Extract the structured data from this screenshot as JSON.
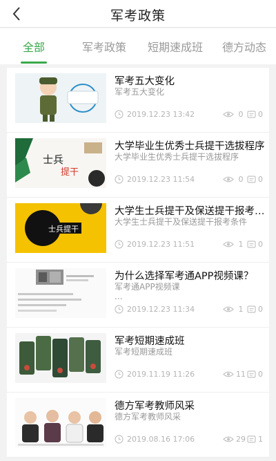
{
  "header": {
    "title": "军考政策",
    "back_icon": "chevron-left-icon"
  },
  "tabs": [
    {
      "label": "全部",
      "active": true
    },
    {
      "label": "军考政策",
      "active": false
    },
    {
      "label": "短期速成班",
      "active": false
    },
    {
      "label": "德方动态",
      "active": false
    }
  ],
  "colors": {
    "accent": "#3aa84a",
    "meta_text": "#b4b4b4"
  },
  "items": [
    {
      "title": "军考五大变化",
      "subtitle": "军考五大变化",
      "extra": "",
      "date": "2019.12.23 13:42",
      "views": "0",
      "comments": "0"
    },
    {
      "title": "大学毕业生优秀士兵提干选拔程序",
      "subtitle": "大学毕业生优秀士兵提干选拔程序",
      "extra": "",
      "date": "2019.12.23 11:54",
      "views": "0",
      "comments": "0",
      "thumb_text": [
        "士兵",
        "提干"
      ]
    },
    {
      "title": "大学生士兵提干及保送提干报考条件",
      "subtitle": "大学生士兵提干及保送提干报考条件",
      "extra": "",
      "date": "2019.12.23 11:51",
      "views": "1",
      "comments": "0",
      "thumb_text": [
        "士兵提干"
      ]
    },
    {
      "title": "为什么选择军考通APP视频课？",
      "subtitle": "军考通APP视频课",
      "extra": "...",
      "date": "2019.12.23 11:34",
      "views": "1",
      "comments": "0"
    },
    {
      "title": "军考短期速成班",
      "subtitle": "军考短期速成班",
      "extra": "",
      "date": "2019.11.19 11:26",
      "views": "11",
      "comments": "0"
    },
    {
      "title": "德方军考教师风采",
      "subtitle": "德方军考教师风采",
      "extra": "",
      "date": "2019.08.16 17:06",
      "views": "29",
      "comments": "1"
    }
  ]
}
